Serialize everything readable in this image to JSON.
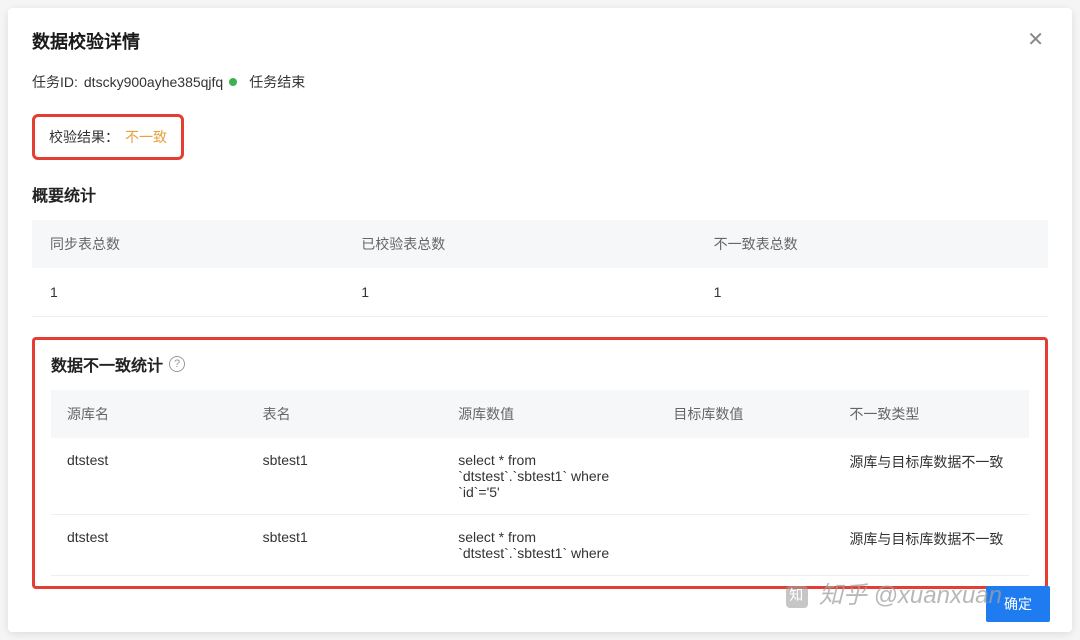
{
  "modal": {
    "title": "数据校验详情"
  },
  "task": {
    "id_label": "任务ID:",
    "id_value": "dtscky900ayhe385qjfq",
    "status": "任务结束"
  },
  "result": {
    "label": "校验结果：",
    "value": "不一致"
  },
  "summary": {
    "title": "概要统计",
    "headers": {
      "total_sync": "同步表总数",
      "total_checked": "已校验表总数",
      "total_inconsistent": "不一致表总数"
    },
    "values": {
      "total_sync": "1",
      "total_checked": "1",
      "total_inconsistent": "1"
    }
  },
  "inconsistent": {
    "title": "数据不一致统计",
    "headers": {
      "src_db": "源库名",
      "table": "表名",
      "src_val": "源库数值",
      "dst_val": "目标库数值",
      "type": "不一致类型"
    },
    "rows": [
      {
        "src_db": "dtstest",
        "table": "sbtest1",
        "src_val": "select * from `dtstest`.`sbtest1` where `id`='5'",
        "dst_val": "",
        "type": "源库与目标库数据不一致"
      },
      {
        "src_db": "dtstest",
        "table": "sbtest1",
        "src_val": "select * from `dtstest`.`sbtest1` where",
        "dst_val": "",
        "type": "源库与目标库数据不一致"
      }
    ]
  },
  "buttons": {
    "confirm": "确定"
  },
  "watermark": "知乎 @xuanxuan"
}
